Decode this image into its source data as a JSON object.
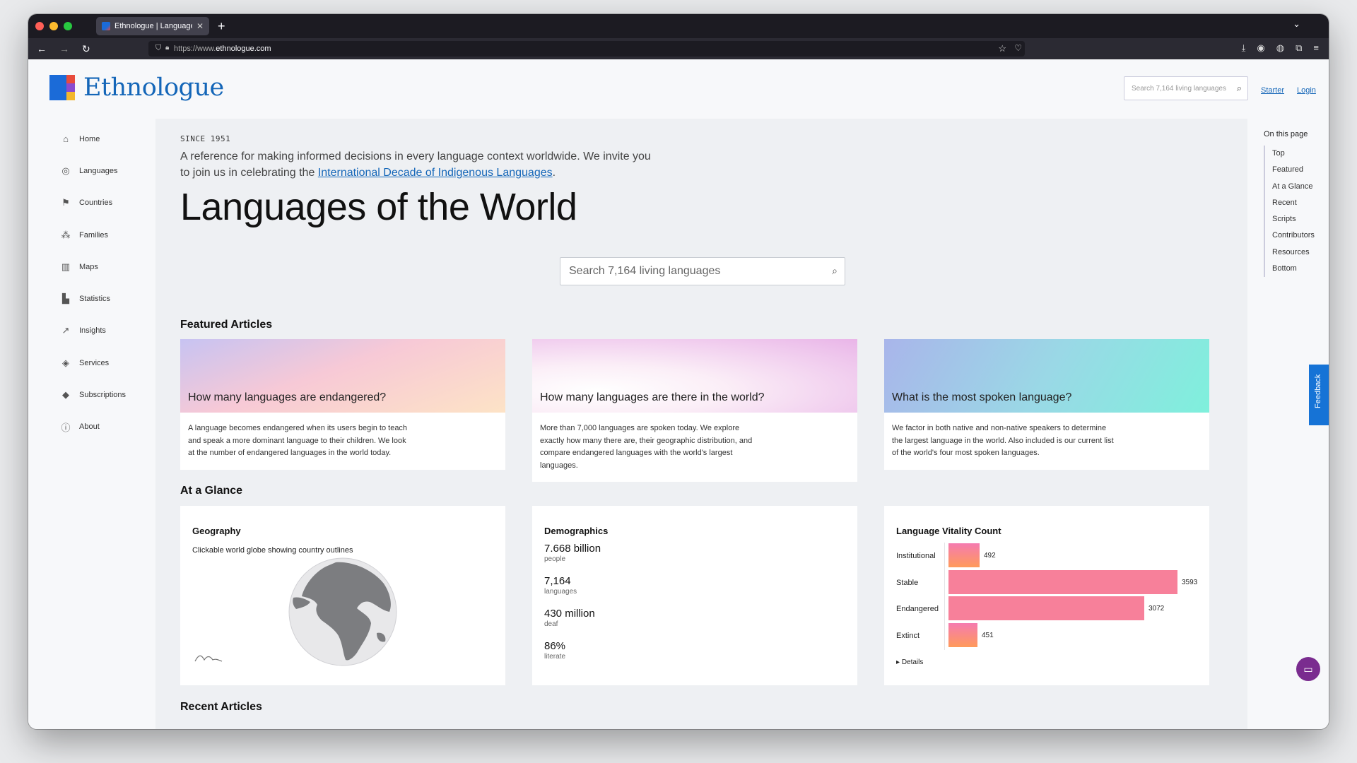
{
  "browser": {
    "tab_title": "Ethnologue | Languages of the",
    "url_prefix": "https://www.",
    "url_domain": "ethnologue.com"
  },
  "header": {
    "logo_text": "Ethnologue",
    "search_placeholder": "Search 7,164 living languages",
    "starter_link": "Starter",
    "login_link": "Login"
  },
  "sidebar": {
    "items": [
      {
        "label": "Home",
        "icon": "home-icon"
      },
      {
        "label": "Languages",
        "icon": "globe-icon"
      },
      {
        "label": "Countries",
        "icon": "flag-icon"
      },
      {
        "label": "Families",
        "icon": "tree-icon"
      },
      {
        "label": "Maps",
        "icon": "map-icon"
      },
      {
        "label": "Statistics",
        "icon": "bar-chart-icon"
      },
      {
        "label": "Insights",
        "icon": "trend-icon"
      },
      {
        "label": "Services",
        "icon": "layers-icon"
      },
      {
        "label": "Subscriptions",
        "icon": "tag-icon"
      },
      {
        "label": "About",
        "icon": "info-icon"
      }
    ]
  },
  "hero": {
    "since": "SINCE 1951",
    "intro_text": "A reference for making informed decisions in every language context worldwide. We invite you to join us in celebrating the",
    "intro_link": "International Decade of Indigenous Languages",
    "intro_end": ".",
    "title": "Languages of the World",
    "search_placeholder": "Search 7,164 living languages"
  },
  "featured": {
    "heading": "Featured Articles",
    "cards": [
      {
        "title": "How many languages are endangered?",
        "body": "A language becomes endangered when its users begin to teach and speak a more dominant language to their children. We look at the number of endangered languages in the world today."
      },
      {
        "title": "How many languages are there in the world?",
        "body": "More than 7,000 languages are spoken today. We explore exactly how many there are, their geographic distribution, and compare endangered languages with the world's largest languages."
      },
      {
        "title": "What is the most spoken language?",
        "body": "We factor in both native and non-native speakers to determine the largest language in the world. Also included is our current list of the world's four most spoken languages."
      }
    ]
  },
  "glance": {
    "heading": "At a Glance",
    "geography": {
      "title": "Geography",
      "caption": "Clickable world globe showing country outlines"
    },
    "demographics": {
      "title": "Demographics",
      "stats": [
        {
          "value": "7.668 billion",
          "label": "people"
        },
        {
          "value": "7,164",
          "label": "languages"
        },
        {
          "value": "430 million",
          "label": "deaf"
        },
        {
          "value": "86%",
          "label": "literate"
        }
      ]
    },
    "vitality": {
      "title": "Language Vitality Count",
      "details": "Details"
    }
  },
  "chart_data": {
    "type": "bar",
    "title": "Language Vitality Count",
    "categories": [
      "Institutional",
      "Stable",
      "Endangered",
      "Extinct"
    ],
    "values": [
      492,
      3593,
      3072,
      451
    ],
    "orientation": "horizontal",
    "color": "#f7809a"
  },
  "recent": {
    "heading": "Recent Articles"
  },
  "toc": {
    "heading": "On this page",
    "items": [
      "Top",
      "Featured",
      "At a Glance",
      "Recent",
      "Scripts",
      "Contributors",
      "Resources",
      "Bottom"
    ]
  },
  "feedback_label": "Feedback"
}
